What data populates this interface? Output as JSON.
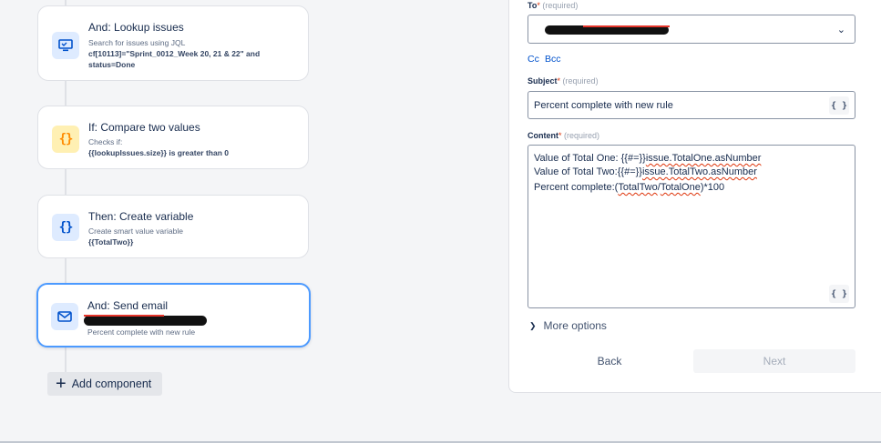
{
  "flow": {
    "cards": [
      {
        "title": "And: Lookup issues",
        "line1": "Search for issues using JQL",
        "line2": "cf[10113]=\"Sprint_0012_Week 20, 21 & 22\" and",
        "line3": "status=Done",
        "icon": "monitor-icon"
      },
      {
        "title": "If: Compare two values",
        "line1": "Checks if:",
        "line2": "{{lookupIssues.size}} is greater than 0",
        "icon": "braces-icon"
      },
      {
        "title": "Then: Create variable",
        "line1": "Create smart value variable",
        "line2": "{{TotalTwo}}",
        "icon": "braces-icon"
      },
      {
        "title": "And: Send email",
        "line2": "Percent complete with new rule",
        "icon": "envelope-icon"
      }
    ],
    "add_component": "Add component"
  },
  "email_form": {
    "to_label": "To",
    "required_text": "(required)",
    "cc": "Cc",
    "bcc": "Bcc",
    "subject_label": "Subject",
    "subject_value": "Percent complete with new rule",
    "content_label": "Content",
    "content_lines": {
      "l1_prefix": "Value of Total One: {{#=}}",
      "l1_word": "issue.TotalOne.asNumber",
      "l2_prefix": "Value of Total Two:{{#=}}",
      "l2_word": "issue.TotalTwo.asNumber",
      "l3_prefix": "Percent complete:(",
      "l3_w1": "TotalTwo",
      "l3_mid": "/",
      "l3_w2": "TotalOne",
      "l3_suffix": ")*100"
    },
    "smart_value_btn": "{ }",
    "more_options": "More options",
    "back": "Back",
    "next": "Next"
  }
}
